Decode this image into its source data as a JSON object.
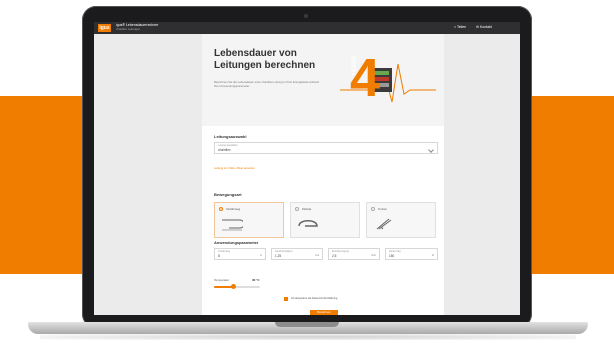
{
  "app": {
    "logo": "igus",
    "title": "igus® Lebensdauerrechner",
    "subtitle": "chainflex Leitungen",
    "share_label": "Teilen",
    "contact_label": "Kontakt"
  },
  "hero": {
    "title": "Lebensdauer von Leitungen berechnen",
    "text": "Berechnen Sie die Lebensdauer einer chainflex Leitung in Ihrer Energiekette anhand Ihrer Anwendungsparameter.",
    "years_number": "4",
    "years_text": "YEARS"
  },
  "cable": {
    "label": "Leitungsauswahl",
    "field_caption": "Leitung auswählen",
    "value": "chainflex",
    "link": "Leitung im Online-Shop ansehen"
  },
  "motion": {
    "label": "Bewegungsart",
    "options": [
      {
        "label": "Verfahrweg",
        "selected": true
      },
      {
        "label": "Zirkular",
        "selected": false
      },
      {
        "label": "Torsion",
        "selected": false
      }
    ]
  },
  "params": {
    "label": "Anwendungsparameter",
    "fields": [
      {
        "caption": "Verfahrweg",
        "value": "8",
        "unit": "m"
      },
      {
        "caption": "Geschwindigkeit",
        "value": "1,25",
        "unit": "m/s"
      },
      {
        "caption": "Beschleunigung",
        "value": "2,5",
        "unit": "m/s²"
      },
      {
        "caption": "Zyklen/Tag",
        "value": "150",
        "unit": "/d"
      }
    ]
  },
  "temperature": {
    "label": "Temperatur",
    "value": "30 °C",
    "level": 0.42
  },
  "consent_text": "Ich akzeptiere die Datenschutzerklärung",
  "calculate_label": "Berechnen",
  "colors": {
    "accent": "#f07d00",
    "dark": "#2f2f31"
  }
}
